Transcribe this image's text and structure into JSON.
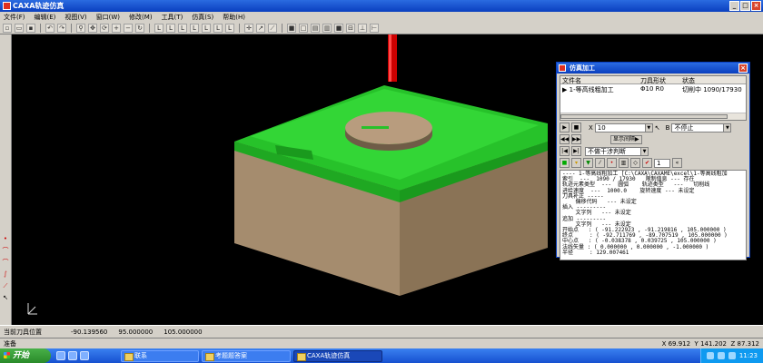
{
  "window": {
    "title": "CAXA轨迹仿真",
    "min": "_",
    "max": "□",
    "close": "×"
  },
  "menu": [
    "文件(F)",
    "编辑(E)",
    "视图(V)",
    "窗口(W)",
    "修改(M)",
    "工具(T)",
    "仿真(S)",
    "帮助(H)"
  ],
  "toolbar_icons": [
    "new-icon",
    "open-icon",
    "save-icon",
    "undo-icon",
    "redo-icon",
    "zoom-icon",
    "pan-icon",
    "rotate-icon",
    "zoom-in-icon",
    "zoom-out-icon",
    "refresh-icon",
    "view-icon",
    "view-icon",
    "view-icon",
    "view-icon",
    "view-icon",
    "view-icon",
    "measure-icon",
    "pick-icon",
    "move-icon",
    "draw-icon",
    "cube-icon",
    "box-icon",
    "shade-icon",
    "tool-icon",
    "stock-icon",
    "setting-icon"
  ],
  "dialog": {
    "title": "仿真加工",
    "columns": [
      "文件名",
      "刀具形状",
      "状态"
    ],
    "row": {
      "name": "1-等高线粗加工",
      "tool": "Φ10 R0",
      "status": "切削中 1090/17930"
    },
    "speed_value": "10",
    "stop_mode": "不停止",
    "stop_label": "B",
    "x_label": "X",
    "interval_btn": "显示间隔▶",
    "check_mode": "不做干涉判断",
    "step_value": "1",
    "log": [
      "---- 1-等高线粗加工 [C:\\CAXA\\CAXAME\\excel\\1-等高线粗加",
      "索引  ---  1090 / 17930   限制值息 --- 存在",
      "轨迹元素类型  ---  圆弧    轨迹类型   ---   切削线",
      "进给速度  ---  1000.0    旋转速度 --- 未设定",
      "刀具补正 -----",
      "    偏移代码   --- 未设定",
      "插入 ---------",
      "    文字列   --- 未设定",
      "追加 ---------",
      "    文字列   --- 未设定",
      "开始点   : ( -91.222923 , -91.219816 , 105.000000 )",
      "终点     : ( -92.711769 , -89.707519 , 105.000000 )",
      "中心点   : ( -0.038378 , 0.039725 , 105.000000 )",
      "法线矢量 : ( 0.000000 , 0.000000 , -1.000000 )",
      "半径     : 129.007461"
    ]
  },
  "status": {
    "label": "当前刀具位置",
    "x": "-90.139560",
    "y": "95.000000",
    "z": "105.000000"
  },
  "status2": {
    "ready": "准备",
    "x": "69.912",
    "y": "141.202",
    "z": "87.312",
    "xl": "X",
    "yl": "Y",
    "zl": "Z"
  },
  "taskbar": {
    "start": "开始",
    "tasks": [
      "联系",
      "考题题答案",
      "CAXA轨迹仿真"
    ],
    "clock": "11:23"
  }
}
